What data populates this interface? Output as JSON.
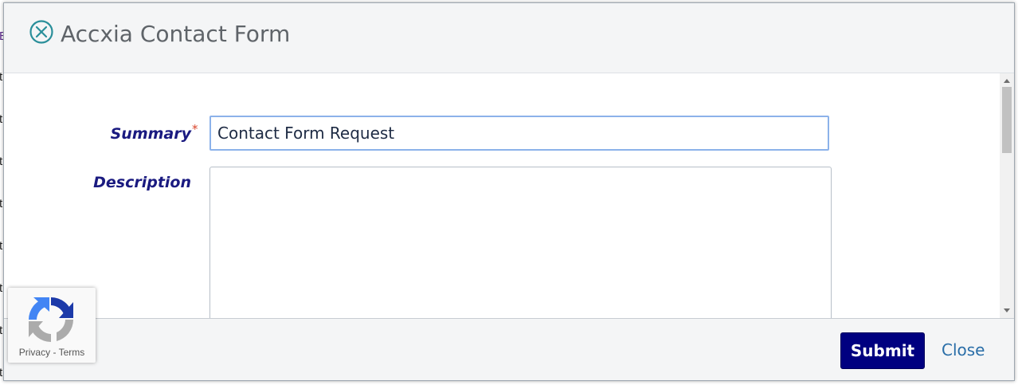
{
  "dialog": {
    "title": "Accxia Contact Form",
    "icon": "accxia-logo-icon"
  },
  "form": {
    "summary": {
      "label": "Summary",
      "required_marker": "*",
      "value": "Contact Form Request"
    },
    "description": {
      "label": "Description",
      "value": ""
    }
  },
  "footer": {
    "submit_label": "Submit",
    "close_label": "Close"
  },
  "recaptcha": {
    "privacy_label": "Privacy",
    "separator": " - ",
    "terms_label": "Terms"
  },
  "colors": {
    "label": "#1a1a80",
    "submit_bg": "#000080",
    "close_link": "#2a6ea8",
    "required": "#d9452b"
  }
}
